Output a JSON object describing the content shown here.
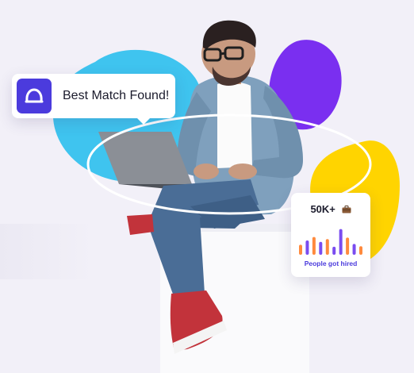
{
  "match_card": {
    "text": "Best Match Found!"
  },
  "stats_card": {
    "count": "50K+",
    "label": "People got hired",
    "bar_levels": [
      0.35,
      0.5,
      0.62,
      0.45,
      0.55,
      0.28,
      0.9,
      0.6,
      0.38,
      0.3
    ],
    "bar_colors": [
      "#ff8a3d",
      "#7a4cf0",
      "#ff8a3d",
      "#7a4cf0",
      "#ff8a3d",
      "#7a4cf0",
      "#7a4cf0",
      "#ff8a3d",
      "#7a4cf0",
      "#ff8a3d"
    ]
  },
  "colors": {
    "blob_blue": "#3fc4ef",
    "blob_purple": "#7a2ff0",
    "blob_yellow": "#ffd400",
    "accent": "#4b3bdd"
  }
}
